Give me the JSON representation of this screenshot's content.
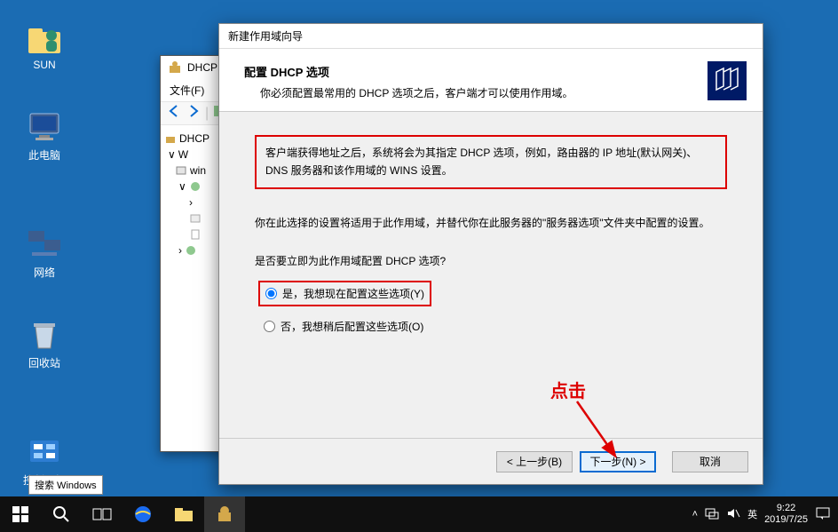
{
  "desktop": {
    "icons": [
      {
        "label": "SUN"
      },
      {
        "label": "此电脑"
      },
      {
        "label": "网络"
      },
      {
        "label": "回收站"
      },
      {
        "label": "控制面板"
      }
    ],
    "search_tooltip": "搜索 Windows"
  },
  "dhcp_window": {
    "title": "DHCP",
    "menu_file": "文件(F)",
    "tree_root": "DHCP",
    "tree_server_prefix": "W",
    "tree_server": "win",
    "close": "×"
  },
  "wizard": {
    "window_title": "新建作用域向导",
    "heading": "配置 DHCP 选项",
    "subheading": "你必须配置最常用的 DHCP 选项之后，客户端才可以使用作用域。",
    "info_box": "客户端获得地址之后，系统将会为其指定 DHCP 选项，例如，路由器的 IP 地址(默认网关)、DNS 服务器和该作用域的 WINS 设置。",
    "instruction": "你在此选择的设置将适用于此作用域，并替代你在此服务器的\"服务器选项\"文件夹中配置的设置。",
    "question": "是否要立即为此作用域配置 DHCP 选项?",
    "radio_yes": "是，我想现在配置这些选项(Y)",
    "radio_no": "否，我想稍后配置这些选项(O)",
    "btn_back": "< 上一步(B)",
    "btn_next": "下一步(N) >",
    "btn_cancel": "取消"
  },
  "annotation": {
    "label": "点击"
  },
  "taskbar": {
    "ime": "英",
    "time": "9:22",
    "date": "2019/7/25"
  }
}
